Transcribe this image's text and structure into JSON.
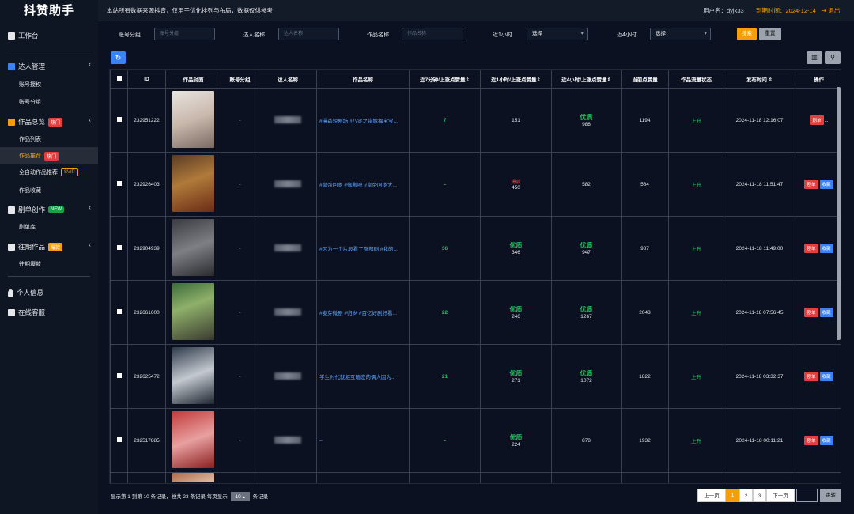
{
  "header": {
    "logo": "抖赞助手",
    "notice": "本站所有数据来源抖音，仅用于优化排列与布局，数据仅供参考",
    "user": "用户名：dyjk33",
    "expire": "到期时间：2024-12-14",
    "logout": "退出"
  },
  "sidebar": {
    "workbench": "工作台",
    "talent_mgmt": "达人管理",
    "account_auth": "账号授权",
    "account_group": "账号分组",
    "works_overview": "作品总览",
    "works_overview_badge": "热门",
    "works_list": "作品列表",
    "works_recommend": "作品推荐",
    "works_recommend_badge": "热门",
    "auto_recommend": "全自动作品推荐",
    "auto_recommend_badge": "SVIP",
    "works_fav": "作品收藏",
    "drama_create": "剧单创作",
    "drama_create_badge": "NEW",
    "drama_lib": "剧单库",
    "past_works": "往期作品",
    "past_works_badge": "爆款",
    "past_hits": "往期爆款",
    "personal": "个人信息",
    "service": "在线客服"
  },
  "filters": {
    "group_label": "账号分组",
    "group_placeholder": "账号分组",
    "talent_label": "达人名称",
    "talent_placeholder": "达人名称",
    "work_label": "作品名称",
    "work_placeholder": "作品名称",
    "h1_label": "近1小时",
    "h1_value": "选择",
    "h4_label": "近4小时",
    "h4_value": "选择",
    "search_btn": "搜索",
    "reset_btn": "重置"
  },
  "table": {
    "headers": {
      "id": "ID",
      "cover": "作品封面",
      "group": "账号分组",
      "talent": "达人名称",
      "work": "作品名称",
      "m7": "近7分钟/上涨点赞量",
      "h1": "近1小时/上涨点赞量",
      "h4": "近4小时/上涨点赞量",
      "cur": "当前点赞量",
      "status": "作品流量状态",
      "time": "发布时间",
      "ops": "操作"
    },
    "rows": [
      {
        "id": "232951222",
        "group": "-",
        "work": "#漫森短剧场 #八零之错嫁福宝宝...",
        "m7": "7",
        "h1_tag": "",
        "h1": "151",
        "h4_tag": "优质",
        "h4": "986",
        "cur": "1194",
        "status": "上升",
        "time": "2024-11-18 12:16:07",
        "op1": "剧单",
        "op2": "..."
      },
      {
        "id": "232926403",
        "group": "-",
        "work": "#皇帝回乡 #御殿吧 #皇帝回乡大...",
        "m7": "–",
        "h1_tag": "爆款",
        "h1": "450",
        "h4_tag": "",
        "h4": "582",
        "cur": "584",
        "status": "上升",
        "time": "2024-11-18 11:51:47",
        "op1": "剧单",
        "op2": "收藏"
      },
      {
        "id": "232904939",
        "group": "-",
        "work": "#因为一个片段看了整部剧 #我的...",
        "m7": "36",
        "h1_tag": "优质",
        "h1": "346",
        "h4_tag": "优质",
        "h4": "947",
        "cur": "987",
        "status": "上升",
        "time": "2024-11-18 11:49:00",
        "op1": "剧单",
        "op2": "收藏"
      },
      {
        "id": "232661600",
        "group": "-",
        "work": "#麦芽微剧 #归乡 #百亿好剧好看...",
        "m7": "22",
        "h1_tag": "优质",
        "h1": "246",
        "h4_tag": "优质",
        "h4": "1267",
        "cur": "2043",
        "status": "上升",
        "time": "2024-11-18 07:56:45",
        "op1": "剧单",
        "op2": "收藏"
      },
      {
        "id": "232625472",
        "group": "-",
        "work": "学生时代就相互暗恋的俩人因为...",
        "m7": "21",
        "h1_tag": "优质",
        "h1": "271",
        "h4_tag": "优质",
        "h4": "1072",
        "cur": "1822",
        "status": "上升",
        "time": "2024-11-18 03:32:37",
        "op1": "剧单",
        "op2": "收藏"
      },
      {
        "id": "232517885",
        "group": "-",
        "work": "–",
        "m7": "–",
        "h1_tag": "优质",
        "h1": "224",
        "h4_tag": "",
        "h4": "878",
        "cur": "1932",
        "status": "上升",
        "time": "2024-11-18 00:11:21",
        "op1": "剧单",
        "op2": "收藏"
      }
    ]
  },
  "footer": {
    "info_a": "显示第 1 到第 10 条记录，总共 23 条记录 每页显示",
    "page_size": "10 ▴",
    "info_b": "条记录",
    "prev": "上一页",
    "p1": "1",
    "p2": "2",
    "p3": "3",
    "next": "下一页",
    "go": "跳转"
  },
  "colors": {
    "accent": "#f59e0b",
    "link": "#60a5fa",
    "good": "#22c55e",
    "hot": "#ef4444"
  }
}
